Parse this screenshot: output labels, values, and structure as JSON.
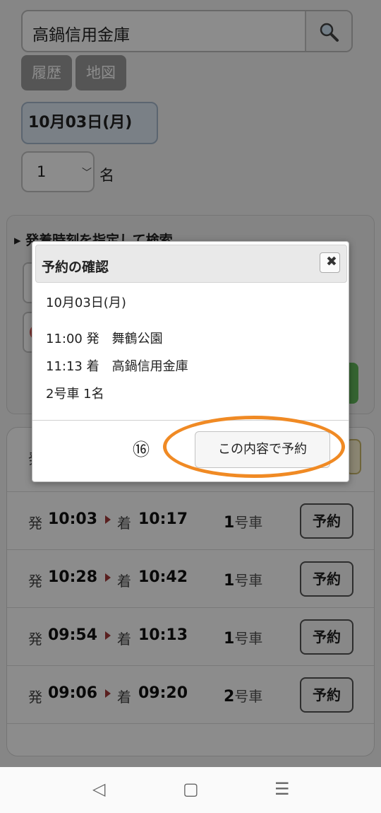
{
  "search": {
    "query": "高鍋信用金庫"
  },
  "chips": {
    "history": "履歴",
    "map": "地図"
  },
  "date_value": "10月03日(月)",
  "passengers": {
    "value": "1",
    "unit": "名"
  },
  "time_panel": {
    "title": "発着時刻を指定して検索"
  },
  "results": {
    "first_row_label": "発",
    "rows": [
      {
        "dep_label": "発",
        "dep": "10:03",
        "arr_label": "着",
        "arr": "10:17",
        "car_num": "1",
        "car_suffix": "号車",
        "button": "予約"
      },
      {
        "dep_label": "発",
        "dep": "10:28",
        "arr_label": "着",
        "arr": "10:42",
        "car_num": "1",
        "car_suffix": "号車",
        "button": "予約"
      },
      {
        "dep_label": "発",
        "dep": "09:54",
        "arr_label": "着",
        "arr": "10:13",
        "car_num": "1",
        "car_suffix": "号車",
        "button": "予約"
      },
      {
        "dep_label": "発",
        "dep": "09:06",
        "arr_label": "着",
        "arr": "09:20",
        "car_num": "2",
        "car_suffix": "号車",
        "button": "予約"
      }
    ]
  },
  "modal": {
    "title": "予約の確認",
    "close_glyph": "✖",
    "date": "10月03日(月)",
    "departure": "11:00 発　舞鶴公園",
    "arrival": "11:13 着　高鍋信用金庫",
    "car": "2号車 1名",
    "step_marker": "⑯",
    "confirm_label": "この内容で予約"
  },
  "navbar": {
    "back": "◁",
    "home": "▢",
    "menu": "☰"
  },
  "colors": {
    "highlight_ring": "#f08a24",
    "overlay": "rgba(0,0,0,0.45)"
  }
}
